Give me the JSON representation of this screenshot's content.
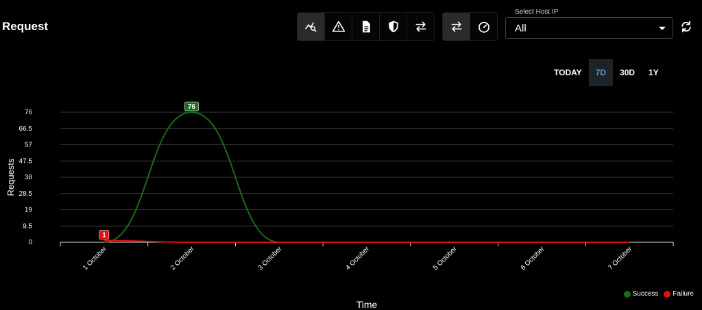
{
  "header": {
    "title": "Request"
  },
  "toolbar": {
    "groups": [
      [
        {
          "name": "analytics",
          "icon": "chart-search-icon",
          "active": true
        },
        {
          "name": "alerts",
          "icon": "warning-icon",
          "active": false
        },
        {
          "name": "logs",
          "icon": "document-icon",
          "active": false
        },
        {
          "name": "security",
          "icon": "shield-icon",
          "active": false
        },
        {
          "name": "transfer",
          "icon": "swap-icon",
          "active": false
        }
      ],
      [
        {
          "name": "traffic",
          "icon": "swap-icon",
          "active": true
        },
        {
          "name": "performance",
          "icon": "speedometer-icon",
          "active": false
        }
      ]
    ]
  },
  "host_select": {
    "label": "Select Host IP",
    "value": "All"
  },
  "range_tabs": [
    {
      "label": "TODAY",
      "active": false
    },
    {
      "label": "7D",
      "active": true
    },
    {
      "label": "30D",
      "active": false
    },
    {
      "label": "1Y",
      "active": false
    }
  ],
  "colors": {
    "success": "#1a6d1a",
    "failure": "#e01010",
    "active_tab_text": "#5d94d6"
  },
  "chart_data": {
    "type": "line",
    "categories": [
      "1 October",
      "2 October",
      "3 October",
      "4 October",
      "5 October",
      "6 October",
      "7 October"
    ],
    "series": [
      {
        "name": "Success",
        "values": [
          0,
          76,
          0,
          0,
          0,
          0,
          0
        ],
        "color": "#1a6d1a",
        "labeled_index": 1,
        "label_text": "76"
      },
      {
        "name": "Failure",
        "values": [
          1,
          0,
          0,
          0,
          0,
          0,
          0
        ],
        "color": "#e01010",
        "labeled_index": 0,
        "label_text": "1"
      }
    ],
    "xlabel": "Time",
    "ylabel": "Requests",
    "yticks": [
      "0",
      "9.5",
      "19",
      "28.5",
      "38",
      "47.5",
      "57",
      "66.5",
      "76"
    ],
    "ylim": [
      0,
      76
    ],
    "grid": true,
    "legend": "bottom-right"
  }
}
